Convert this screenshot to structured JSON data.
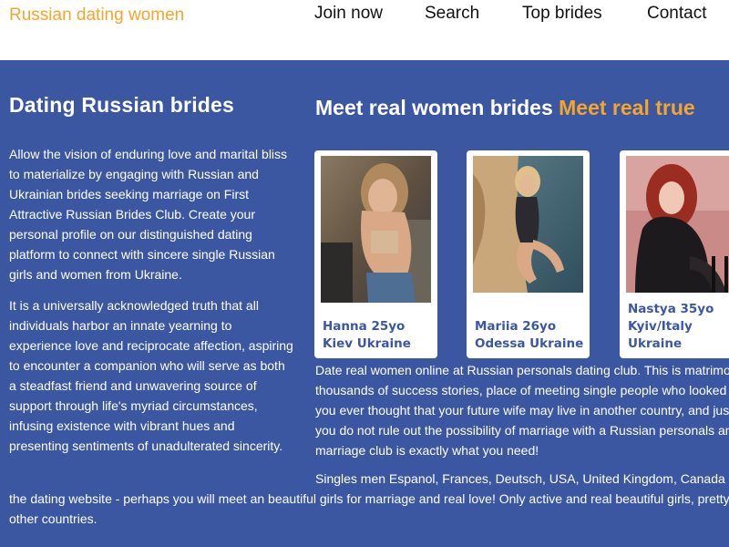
{
  "header": {
    "logo": "Russian dating women",
    "nav": [
      "Join now",
      "Search",
      "Top brides",
      "Contact"
    ]
  },
  "left": {
    "title": "Dating Russian brides",
    "p1": "Allow the vision of enduring love and marital bliss to materialize by engaging with Russian and Ukrainian brides seeking marriage on First Attractive Russian Brides Club. Create your personal profile on our distinguished dating platform to connect with sincere single Russian girls and women from Ukraine.",
    "p2": "It is a universally acknowledged truth that all individuals harbor an innate yearning to experience love and reciprocate affection, aspiring to encounter a companion who will serve as both a steadfast friend and unwavering source of support through life's myriad circumstances, infusing existence with vibrant hues and presenting sentiments of unadulterated sincerity."
  },
  "right": {
    "title_white": "Meet real women brides",
    "title_orange": "Meet real true"
  },
  "cards": [
    {
      "line1": "Hanna 25yo",
      "line2": "Kiev Ukraine"
    },
    {
      "line1": "Mariia 26yo",
      "line2": "Odessa Ukraine"
    },
    {
      "line1": "Nastya 35yo",
      "line2": "Kyiv/Italy",
      "line3": "Ukraine"
    }
  ],
  "body": {
    "lines": [
      "Date real women online at Russian personals dating club. This is matrimonial",
      "thousands of success stories, place of meeting single people who looked for",
      "you ever thought that your future wife may live in another country, and just s",
      "you do not rule out the possibility of marriage with a Russian personals and",
      "marriage club is exactly what you need!"
    ],
    "p2_lines": [
      "Singles men Espanol, Frances, Deutsch, USA, United Kingdom, Canada ca",
      "the dating website - perhaps you will meet an beautiful girls for marriage and real love! Only active and real beautiful girls, pretty wo",
      "other countries."
    ]
  },
  "colors": {
    "brand_orange": "#f4a52c",
    "main_blue": "#3b57a2"
  }
}
